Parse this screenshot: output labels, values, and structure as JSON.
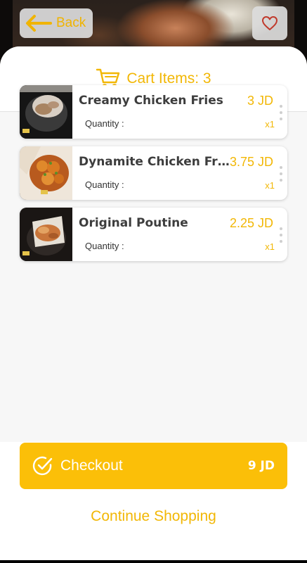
{
  "header": {
    "back_label": "Back",
    "back_icon": "arrow-left-icon",
    "favorite_icon": "heart-icon"
  },
  "cart": {
    "title": "Cart Items: 3",
    "icon": "cart-icon"
  },
  "items": [
    {
      "name": "Creamy Chicken Fries",
      "price": "3 JD",
      "quantity_label": "Quantity :",
      "quantity": "x1"
    },
    {
      "name": "Dynamite Chicken Fries",
      "price": "3.75 JD",
      "quantity_label": "Quantity :",
      "quantity": "x1"
    },
    {
      "name": "Original Poutine",
      "price": "2.25 JD",
      "quantity_label": "Quantity :",
      "quantity": "x1"
    }
  ],
  "checkout": {
    "label": "Checkout",
    "total": "9 JD",
    "icon": "check-circle-icon"
  },
  "continue_label": "Continue Shopping",
  "colors": {
    "accent": "#f2b705",
    "checkout_bg": "#fbbf08",
    "text_dark": "#3d3d3d"
  }
}
